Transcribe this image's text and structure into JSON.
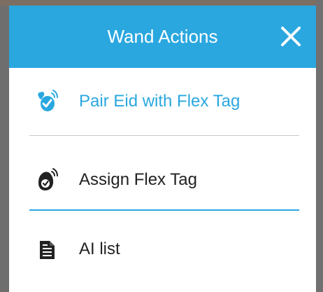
{
  "dialog": {
    "title": "Wand Actions",
    "close_icon": "close-icon",
    "accent_color": "#2aa7df"
  },
  "menu": {
    "items": [
      {
        "label": "Pair Eid with Flex Tag",
        "icon": "pair-tag-icon",
        "color": "#2aa7df"
      },
      {
        "label": "Assign Flex Tag",
        "icon": "assign-tag-icon",
        "color": "#222222"
      },
      {
        "label": "AI list",
        "icon": "document-list-icon",
        "color": "#222222"
      }
    ]
  }
}
